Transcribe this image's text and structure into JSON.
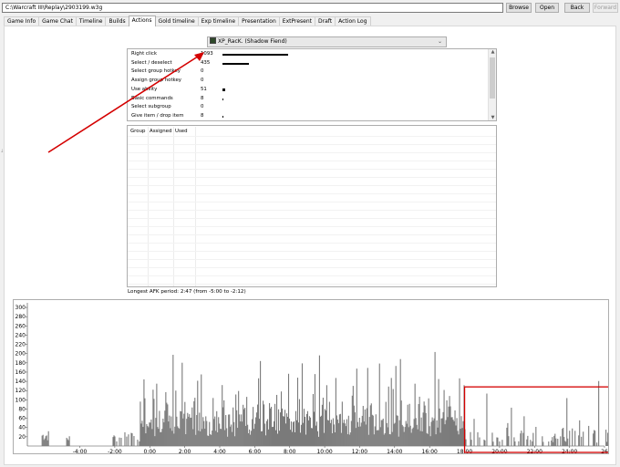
{
  "toolbar": {
    "path": "C:\\Warcraft III\\Replay\\2903199.w3g",
    "browse": "Browse",
    "open": "Open",
    "back": "Back",
    "forward": "Forward"
  },
  "tabs": [
    "Game Info",
    "Game Chat",
    "Timeline",
    "Builds",
    "Actions",
    "Gold timeline",
    "Exp timeline",
    "Presentation",
    "ExtPresent",
    "Draft",
    "Action Log"
  ],
  "active_tab": "Actions",
  "player": {
    "name": "XP_RacK. (Shadow Fiend)"
  },
  "actions": [
    {
      "name": "Right click",
      "count": "1093",
      "level": 1.0
    },
    {
      "name": "Select / deselect",
      "count": "435",
      "level": 0.398
    },
    {
      "name": "Select group hotkey",
      "count": "0",
      "level": 0
    },
    {
      "name": "Assign group hotkey",
      "count": "0",
      "level": 0
    },
    {
      "name": "Use ability",
      "count": "51",
      "level": 0.047
    },
    {
      "name": "Basic commands",
      "count": "8",
      "level": 0.007
    },
    {
      "name": "Select subgroup",
      "count": "0",
      "level": 0
    },
    {
      "name": "Give item / drop item",
      "count": "8",
      "level": 0.007
    }
  ],
  "group_columns": [
    "Group",
    "Assigned",
    "Used"
  ],
  "afk_text": "Longest AFK period: 2:47 (from -5:00 to -2:12)",
  "chart_data": {
    "type": "bar",
    "title": "",
    "xlabel": "",
    "ylabel": "",
    "x_range_min": [
      -7,
      26
    ],
    "ylim": [
      0,
      310
    ],
    "y_ticks": [
      20,
      40,
      60,
      80,
      100,
      120,
      140,
      160,
      180,
      200,
      220,
      240,
      260,
      280,
      300
    ],
    "x_ticks": [
      "-4:00",
      "-2:00",
      "0:00",
      "2:00",
      "4:00",
      "6:00",
      "8:00",
      "10:00",
      "12:00",
      "14:00",
      "16:00",
      "18:00",
      "20:00",
      "22:00",
      "24:00",
      "26"
    ],
    "x_tick_minutes": [
      -4,
      -2,
      0,
      2,
      4,
      6,
      8,
      10,
      12,
      14,
      16,
      18,
      20,
      22,
      24,
      26
    ],
    "bar_color": "#7a7a7a",
    "highlight_box_minutes": [
      18,
      26.5
    ],
    "highlight_color": "#d40000",
    "note_source": "actions per time bucket (estimated envelope)"
  },
  "colors": {
    "annotation": "#d40000"
  }
}
